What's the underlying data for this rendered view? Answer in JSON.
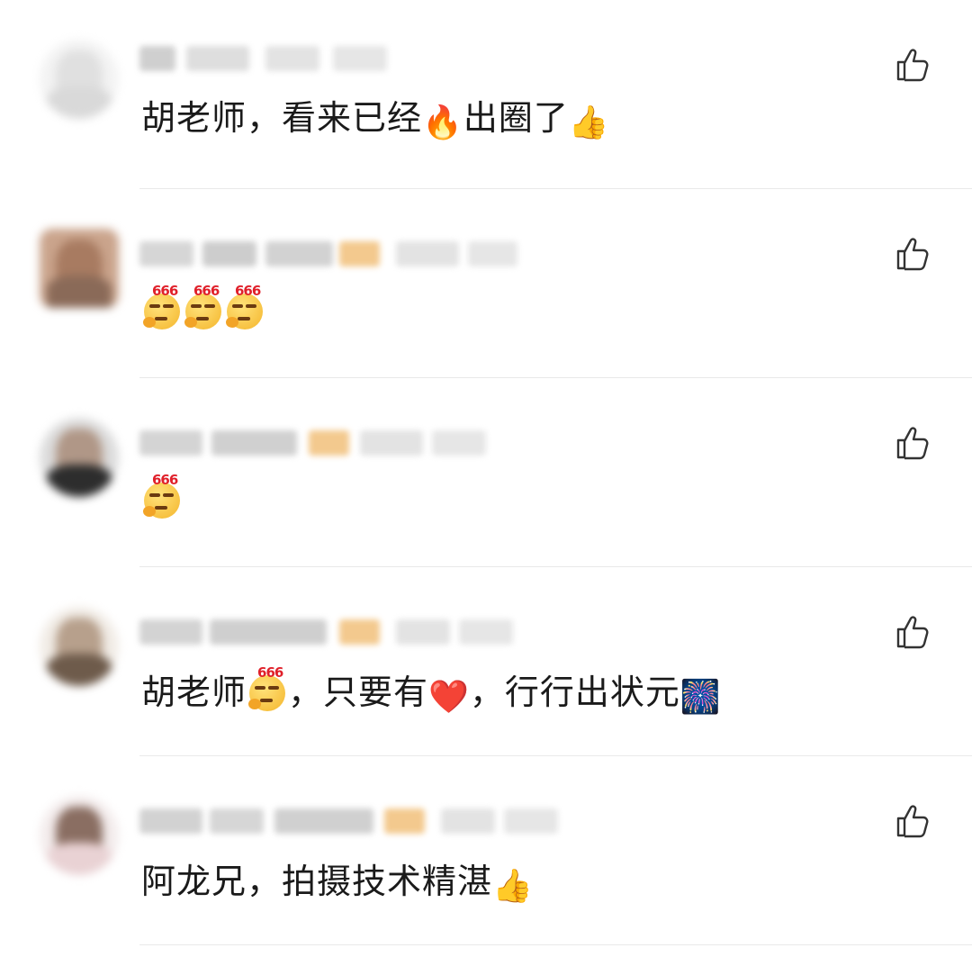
{
  "comments": [
    {
      "text_parts": [
        "胡老师，看来已经",
        "🔥",
        "出圈了",
        "👍"
      ],
      "avatar": {
        "bg": "#f3f3f3",
        "head": "#e0e0e0",
        "body": "#d9d9d9"
      }
    },
    {
      "text_parts": [
        "666",
        "666",
        "666"
      ],
      "avatar": {
        "bg": "#caa48c",
        "head": "#a87b61",
        "body": "#8a6a58"
      }
    },
    {
      "text_parts": [
        "666"
      ],
      "avatar": {
        "bg": "#dcdcdc",
        "head": "#b09787",
        "body": "#2d2d2d"
      }
    },
    {
      "text_parts": [
        "胡老师",
        "666",
        "，只要有",
        "❤️",
        "，行行出状元",
        "🎆"
      ],
      "avatar": {
        "bg": "#f1ece6",
        "head": "#b7a08c",
        "body": "#6e5b4b"
      }
    },
    {
      "text_parts": [
        "阿龙兄，拍摄技术精湛",
        "👍"
      ],
      "avatar": {
        "bg": "#f3ecec",
        "head": "#8a6e62",
        "body": "#e9d2d4"
      }
    }
  ],
  "like_icon": "thumbs-up-outline-icon",
  "colors": {
    "text": "#1a1a1a",
    "divider": "#e9e9e9",
    "icon": "#333333",
    "blur": "#d8d8d8",
    "badge_blur": "#f3c98e"
  }
}
